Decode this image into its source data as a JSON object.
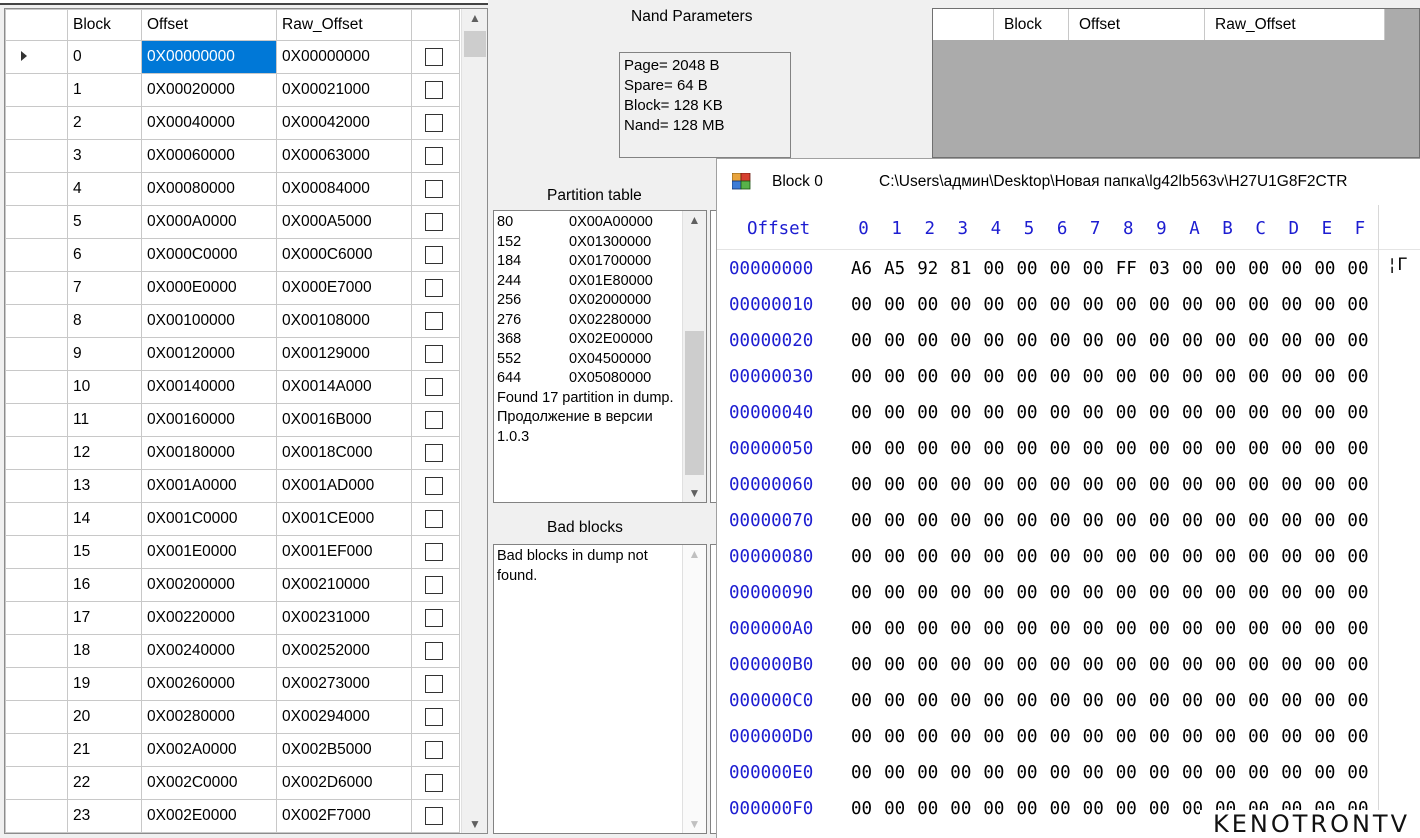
{
  "left_grid": {
    "columns": [
      "Block",
      "Offset",
      "Raw_Offset"
    ],
    "rows": [
      [
        "0",
        "0X00000000",
        "0X00000000"
      ],
      [
        "1",
        "0X00020000",
        "0X00021000"
      ],
      [
        "2",
        "0X00040000",
        "0X00042000"
      ],
      [
        "3",
        "0X00060000",
        "0X00063000"
      ],
      [
        "4",
        "0X00080000",
        "0X00084000"
      ],
      [
        "5",
        "0X000A0000",
        "0X000A5000"
      ],
      [
        "6",
        "0X000C0000",
        "0X000C6000"
      ],
      [
        "7",
        "0X000E0000",
        "0X000E7000"
      ],
      [
        "8",
        "0X00100000",
        "0X00108000"
      ],
      [
        "9",
        "0X00120000",
        "0X00129000"
      ],
      [
        "10",
        "0X00140000",
        "0X0014A000"
      ],
      [
        "11",
        "0X00160000",
        "0X0016B000"
      ],
      [
        "12",
        "0X00180000",
        "0X0018C000"
      ],
      [
        "13",
        "0X001A0000",
        "0X001AD000"
      ],
      [
        "14",
        "0X001C0000",
        "0X001CE000"
      ],
      [
        "15",
        "0X001E0000",
        "0X001EF000"
      ],
      [
        "16",
        "0X00200000",
        "0X00210000"
      ],
      [
        "17",
        "0X00220000",
        "0X00231000"
      ],
      [
        "18",
        "0X00240000",
        "0X00252000"
      ],
      [
        "19",
        "0X00260000",
        "0X00273000"
      ],
      [
        "20",
        "0X00280000",
        "0X00294000"
      ],
      [
        "21",
        "0X002A0000",
        "0X002B5000"
      ],
      [
        "22",
        "0X002C0000",
        "0X002D6000"
      ],
      [
        "23",
        "0X002E0000",
        "0X002F7000"
      ]
    ],
    "selected_row": 0
  },
  "nand_parameters": {
    "title": "Nand Parameters",
    "lines": [
      "Page= 2048 B",
      "Spare= 64 B",
      "Block= 128 KB",
      "Nand= 128 MB"
    ]
  },
  "partition_table": {
    "title": "Partition table",
    "rows": [
      [
        "80",
        "0X00A00000"
      ],
      [
        "152",
        "0X01300000"
      ],
      [
        "184",
        "0X01700000"
      ],
      [
        "244",
        "0X01E80000"
      ],
      [
        "256",
        "0X02000000"
      ],
      [
        "276",
        "0X02280000"
      ],
      [
        "368",
        "0X02E00000"
      ],
      [
        "552",
        "0X04500000"
      ],
      [
        "644",
        "0X05080000"
      ]
    ],
    "message": "Found 17 partition in dump.",
    "note": "Продолжение в версии 1.0.3"
  },
  "bad_blocks": {
    "title": "Bad blocks",
    "message": "Bad blocks in dump not found."
  },
  "right_grid": {
    "columns": [
      "Block",
      "Offset",
      "Raw_Offset"
    ]
  },
  "hex_window": {
    "title": "Block 0",
    "path": "C:\\Users\\админ\\Desktop\\Новая папка\\lg42lb563v\\H27U1G8F2CTR",
    "offset_header": "Offset",
    "column_headers": [
      "0",
      "1",
      "2",
      "3",
      "4",
      "5",
      "6",
      "7",
      "8",
      "9",
      "A",
      "B",
      "C",
      "D",
      "E",
      "F"
    ],
    "ascii_first_row": "¦Г",
    "rows": [
      {
        "offset": "00000000",
        "bytes": [
          "A6",
          "A5",
          "92",
          "81",
          "00",
          "00",
          "00",
          "00",
          "FF",
          "03",
          "00",
          "00",
          "00",
          "00",
          "00",
          "00"
        ]
      },
      {
        "offset": "00000010",
        "bytes": [
          "00",
          "00",
          "00",
          "00",
          "00",
          "00",
          "00",
          "00",
          "00",
          "00",
          "00",
          "00",
          "00",
          "00",
          "00",
          "00"
        ]
      },
      {
        "offset": "00000020",
        "bytes": [
          "00",
          "00",
          "00",
          "00",
          "00",
          "00",
          "00",
          "00",
          "00",
          "00",
          "00",
          "00",
          "00",
          "00",
          "00",
          "00"
        ]
      },
      {
        "offset": "00000030",
        "bytes": [
          "00",
          "00",
          "00",
          "00",
          "00",
          "00",
          "00",
          "00",
          "00",
          "00",
          "00",
          "00",
          "00",
          "00",
          "00",
          "00"
        ]
      },
      {
        "offset": "00000040",
        "bytes": [
          "00",
          "00",
          "00",
          "00",
          "00",
          "00",
          "00",
          "00",
          "00",
          "00",
          "00",
          "00",
          "00",
          "00",
          "00",
          "00"
        ]
      },
      {
        "offset": "00000050",
        "bytes": [
          "00",
          "00",
          "00",
          "00",
          "00",
          "00",
          "00",
          "00",
          "00",
          "00",
          "00",
          "00",
          "00",
          "00",
          "00",
          "00"
        ]
      },
      {
        "offset": "00000060",
        "bytes": [
          "00",
          "00",
          "00",
          "00",
          "00",
          "00",
          "00",
          "00",
          "00",
          "00",
          "00",
          "00",
          "00",
          "00",
          "00",
          "00"
        ]
      },
      {
        "offset": "00000070",
        "bytes": [
          "00",
          "00",
          "00",
          "00",
          "00",
          "00",
          "00",
          "00",
          "00",
          "00",
          "00",
          "00",
          "00",
          "00",
          "00",
          "00"
        ]
      },
      {
        "offset": "00000080",
        "bytes": [
          "00",
          "00",
          "00",
          "00",
          "00",
          "00",
          "00",
          "00",
          "00",
          "00",
          "00",
          "00",
          "00",
          "00",
          "00",
          "00"
        ]
      },
      {
        "offset": "00000090",
        "bytes": [
          "00",
          "00",
          "00",
          "00",
          "00",
          "00",
          "00",
          "00",
          "00",
          "00",
          "00",
          "00",
          "00",
          "00",
          "00",
          "00"
        ]
      },
      {
        "offset": "000000A0",
        "bytes": [
          "00",
          "00",
          "00",
          "00",
          "00",
          "00",
          "00",
          "00",
          "00",
          "00",
          "00",
          "00",
          "00",
          "00",
          "00",
          "00"
        ]
      },
      {
        "offset": "000000B0",
        "bytes": [
          "00",
          "00",
          "00",
          "00",
          "00",
          "00",
          "00",
          "00",
          "00",
          "00",
          "00",
          "00",
          "00",
          "00",
          "00",
          "00"
        ]
      },
      {
        "offset": "000000C0",
        "bytes": [
          "00",
          "00",
          "00",
          "00",
          "00",
          "00",
          "00",
          "00",
          "00",
          "00",
          "00",
          "00",
          "00",
          "00",
          "00",
          "00"
        ]
      },
      {
        "offset": "000000D0",
        "bytes": [
          "00",
          "00",
          "00",
          "00",
          "00",
          "00",
          "00",
          "00",
          "00",
          "00",
          "00",
          "00",
          "00",
          "00",
          "00",
          "00"
        ]
      },
      {
        "offset": "000000E0",
        "bytes": [
          "00",
          "00",
          "00",
          "00",
          "00",
          "00",
          "00",
          "00",
          "00",
          "00",
          "00",
          "00",
          "00",
          "00",
          "00",
          "00"
        ]
      },
      {
        "offset": "000000F0",
        "bytes": [
          "00",
          "00",
          "00",
          "00",
          "00",
          "00",
          "00",
          "00",
          "00",
          "00",
          "00",
          "00",
          "00",
          "00",
          "00",
          "00"
        ]
      }
    ]
  },
  "watermark": "KENOTRONTV",
  "colors": {
    "selection": "#0078d7",
    "hex_blue": "#1d1dd1",
    "grey_panel": "#ababab"
  }
}
